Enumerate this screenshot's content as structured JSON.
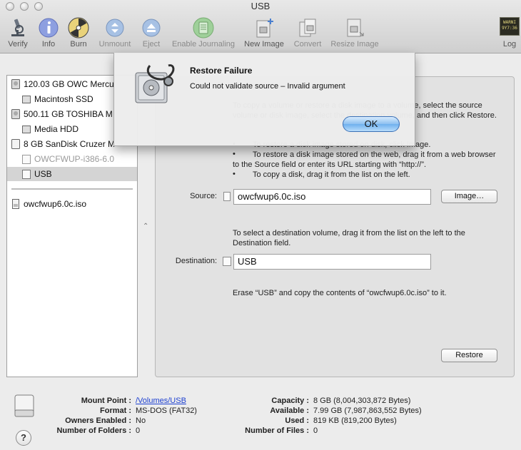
{
  "window": {
    "title": "USB"
  },
  "toolbar": {
    "verify": "Verify",
    "info": "Info",
    "burn": "Burn",
    "unmount": "Unmount",
    "eject": "Eject",
    "enable_journaling": "Enable Journaling",
    "new_image": "New Image",
    "convert": "Convert",
    "resize_image": "Resize Image",
    "log": "Log",
    "log_icon_text": "WARNI\n9Y7:36"
  },
  "sidebar": {
    "items": [
      {
        "label": "120.03 GB OWC Mercu",
        "icon": "internal-disk-icon"
      },
      {
        "label": "Macintosh SSD",
        "icon": "volume-icon"
      },
      {
        "label": "500.11 GB TOSHIBA M",
        "icon": "internal-disk-icon"
      },
      {
        "label": "Media HDD",
        "icon": "volume-icon"
      },
      {
        "label": "8 GB SanDisk Cruzer M",
        "icon": "usb-disk-icon"
      },
      {
        "label": "OWCFWUP-i386-6.0",
        "icon": "volume-icon",
        "dimmed": true
      },
      {
        "label": "USB",
        "icon": "volume-icon",
        "selected": true
      },
      {
        "label": "owcfwup6.0c.iso",
        "icon": "disk-image-icon"
      }
    ]
  },
  "restore": {
    "intro": "To copy a volume or restore a disk image to a volume, select the source volume or disk image, select the destination volume, and then click Restore.",
    "bullet1": "To restore a disk image stored on disk, click Image.",
    "bullet2": "To restore a disk image stored on the web, drag it from a web browser to the Source field or enter its URL starting with “http://”.",
    "bullet3": "To copy a disk, drag it from the list on the left.",
    "source_label": "Source:",
    "source_value": "owcfwup6.0c.iso",
    "image_button": "Image…",
    "dest_help": "To select a destination volume, drag it from the list on the left to the Destination field.",
    "destination_label": "Destination:",
    "destination_value": "USB",
    "summary": "Erase “USB” and copy the contents of “owcfwup6.0c.iso” to it.",
    "restore_button": "Restore"
  },
  "alert": {
    "title": "Restore Failure",
    "message": "Could not validate source – Invalid argument",
    "ok": "OK"
  },
  "info": {
    "mount_point_label": "Mount Point :",
    "mount_point": "/Volumes/USB",
    "format_label": "Format :",
    "format": "MS-DOS (FAT32)",
    "owners_label": "Owners Enabled :",
    "owners": "No",
    "folders_label": "Number of Folders :",
    "folders": "0",
    "capacity_label": "Capacity :",
    "capacity": "8 GB (8,004,303,872 Bytes)",
    "available_label": "Available :",
    "available": "7.99 GB (7,987,863,552 Bytes)",
    "used_label": "Used :",
    "used": "819 KB (819,200 Bytes)",
    "files_label": "Number of Files :",
    "files": "0",
    "help": "?"
  }
}
